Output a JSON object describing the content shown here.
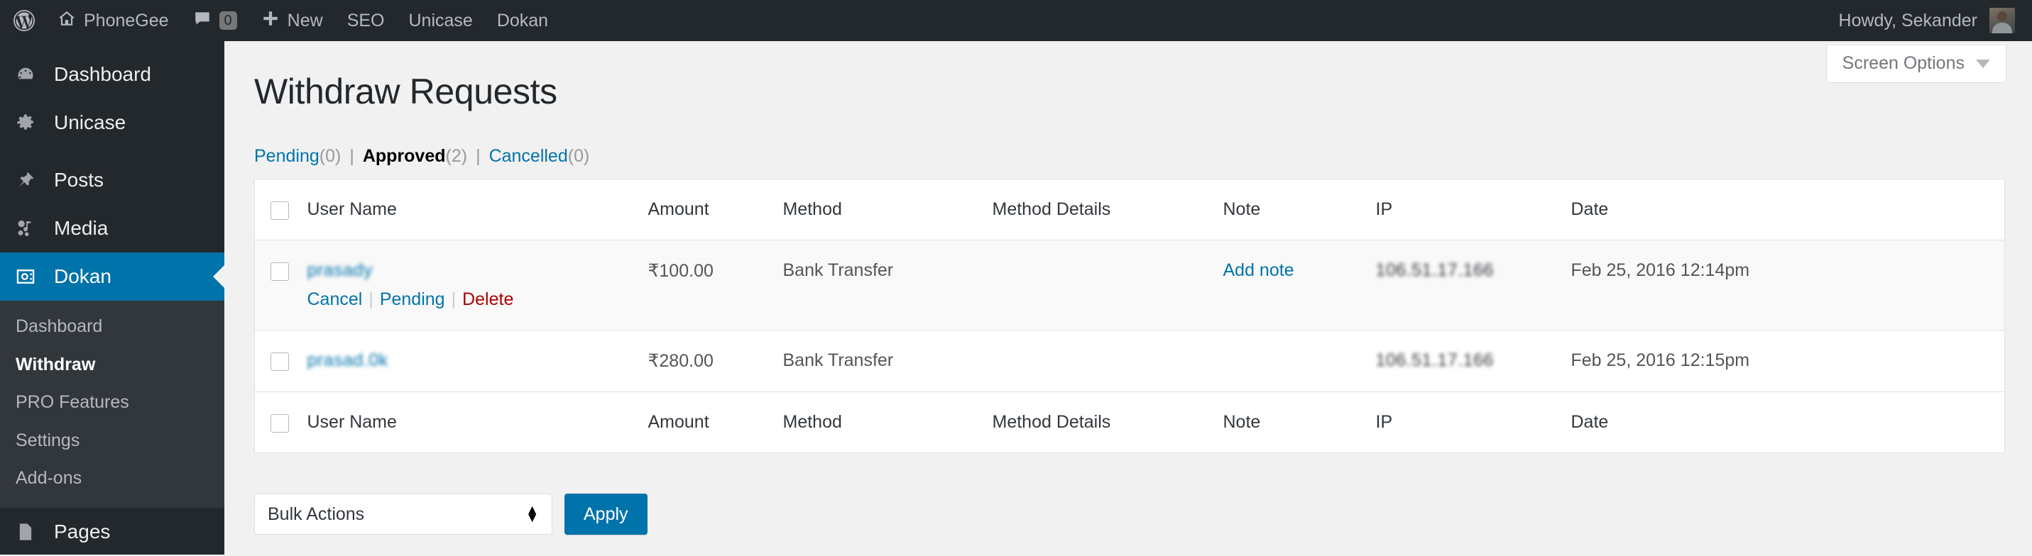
{
  "adminbar": {
    "wp_logo": "wordpress-logo-icon",
    "site_name": "PhoneGee",
    "comment_count": "0",
    "new_label": "New",
    "items": [
      "SEO",
      "Unicase",
      "Dokan"
    ],
    "howdy": "Howdy, Sekander"
  },
  "sidebar": {
    "items": [
      {
        "label": "Dashboard",
        "icon": "dashboard-icon",
        "active": false
      },
      {
        "label": "Unicase",
        "icon": "gear-icon",
        "active": false
      },
      {
        "label": "Posts",
        "icon": "pin-icon",
        "active": false
      },
      {
        "label": "Media",
        "icon": "media-icon",
        "active": false
      },
      {
        "label": "Dokan",
        "icon": "dokan-icon",
        "active": true
      },
      {
        "label": "Pages",
        "icon": "page-icon",
        "active": false
      }
    ],
    "submenu": [
      {
        "label": "Dashboard",
        "current": false
      },
      {
        "label": "Withdraw",
        "current": true
      },
      {
        "label": "PRO Features",
        "current": false
      },
      {
        "label": "Settings",
        "current": false
      },
      {
        "label": "Add-ons",
        "current": false
      }
    ]
  },
  "screen_options": {
    "label": "Screen Options",
    "icon": "chevron-down-icon"
  },
  "page": {
    "title": "Withdraw Requests"
  },
  "filters": [
    {
      "label": "Pending",
      "count": "(0)",
      "current": false
    },
    {
      "label": "Approved",
      "count": "(2)",
      "current": true
    },
    {
      "label": "Cancelled",
      "count": "(0)",
      "current": false
    }
  ],
  "table": {
    "columns": [
      "User Name",
      "Amount",
      "Method",
      "Method Details",
      "Note",
      "IP",
      "Date"
    ],
    "rows": [
      {
        "user": "prasady",
        "actions": [
          {
            "label": "Cancel",
            "style": "link"
          },
          {
            "label": "Pending",
            "style": "link"
          },
          {
            "label": "Delete",
            "style": "delete"
          }
        ],
        "amount": "₹100.00",
        "method": "Bank Transfer",
        "method_details": "",
        "note": "Add note",
        "ip": "106.51.17.166",
        "date": "Feb 25, 2016 12:14pm"
      },
      {
        "user": "prasad.0k",
        "actions": [],
        "amount": "₹280.00",
        "method": "Bank Transfer",
        "method_details": "",
        "note": "",
        "ip": "106.51.17.166",
        "date": "Feb 25, 2016 12:15pm"
      }
    ]
  },
  "tablenav": {
    "bulk_label": "Bulk Actions",
    "apply_label": "Apply"
  },
  "colors": {
    "accent": "#0073aa",
    "adminbar_bg": "#23282d",
    "submenu_bg": "#32373c",
    "delete_red": "#a00"
  }
}
